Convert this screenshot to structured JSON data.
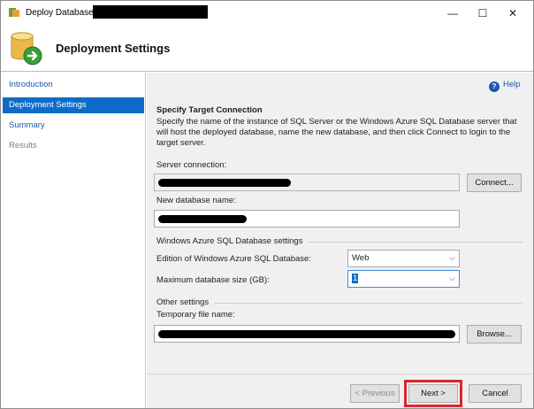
{
  "window": {
    "title": "Deploy Database",
    "controls": {
      "minimize": "—",
      "maximize": "☐",
      "close": "✕"
    }
  },
  "header": {
    "title": "Deployment Settings"
  },
  "sidebar": {
    "items": [
      {
        "label": "Introduction",
        "state": "link"
      },
      {
        "label": "Deployment Settings",
        "state": "active"
      },
      {
        "label": "Summary",
        "state": "link"
      },
      {
        "label": "Results",
        "state": "disabled"
      }
    ]
  },
  "main": {
    "help_label": "Help",
    "section_title": "Specify Target Connection",
    "description": "Specify the name of the instance of SQL Server or the Windows Azure SQL Database server that will host the deployed database, name the new database, and then click Connect to login to the target server.",
    "server_connection": {
      "label": "Server connection:",
      "connect_button": "Connect..."
    },
    "new_database": {
      "label": "New database name:"
    },
    "azure_group": {
      "title": "Windows Azure SQL Database settings",
      "edition": {
        "label": "Edition of Windows Azure SQL Database:",
        "value": "Web"
      },
      "max_size": {
        "label": "Maximum database size (GB):",
        "value": "1"
      }
    },
    "other_group": {
      "title": "Other settings",
      "temp_file": {
        "label": "Temporary file name:",
        "browse_button": "Browse..."
      }
    },
    "footer": {
      "previous_button": "< Previous",
      "next_button": "Next >",
      "cancel_button": "Cancel"
    }
  },
  "colors": {
    "accent": "#0e6cc9",
    "link": "#1c5aa6",
    "highlight_box": "#d9272e"
  }
}
